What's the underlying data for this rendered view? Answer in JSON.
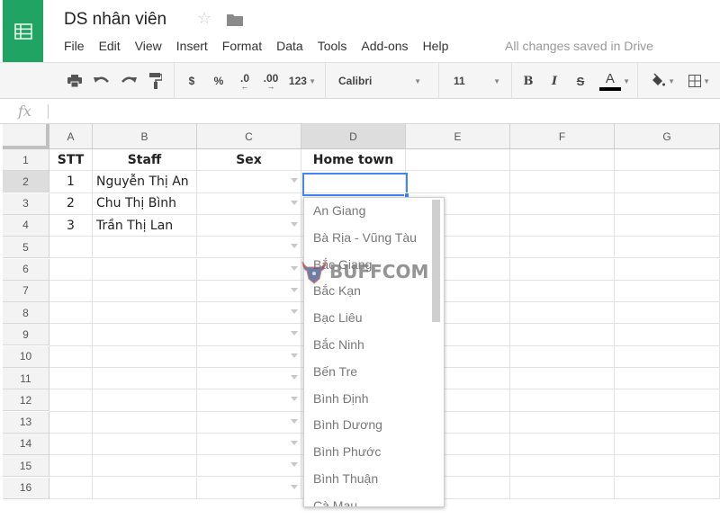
{
  "app": {
    "doc_title": "DS nhân viên",
    "save_status": "All changes saved in Drive",
    "brand_color": "#1fa463",
    "selection_color": "#4285f4"
  },
  "menu": [
    "File",
    "Edit",
    "View",
    "Insert",
    "Format",
    "Data",
    "Tools",
    "Add-ons",
    "Help"
  ],
  "toolbar": {
    "currency": "$",
    "percent": "%",
    "decrease_decimal": ".0",
    "increase_decimal": ".00",
    "more_formats": "123",
    "font": "Calibri",
    "font_size": "11",
    "bold": "B",
    "italic": "I",
    "strikethrough": "S",
    "text_color": "A"
  },
  "formula_bar": {
    "fx_label": "fx",
    "value": ""
  },
  "sheet": {
    "columns": [
      "A",
      "B",
      "C",
      "D",
      "E",
      "F",
      "G"
    ],
    "rows": [
      "1",
      "2",
      "3",
      "4",
      "5",
      "6",
      "7",
      "8",
      "9",
      "10",
      "11",
      "12",
      "13",
      "14",
      "15",
      "16"
    ],
    "header_row": {
      "A": "STT",
      "B": "Staff",
      "C": "Sex",
      "D": "Home town"
    },
    "data": [
      {
        "A": "1",
        "B": "Nguyễn Thị An",
        "C": "",
        "D": ""
      },
      {
        "A": "2",
        "B": "Chu Thị Bình",
        "C": "",
        "D": ""
      },
      {
        "A": "3",
        "B": "Trần Thị Lan",
        "C": "",
        "D": ""
      }
    ],
    "active_cell": "D2"
  },
  "dropdown": {
    "options": [
      "An Giang",
      "Bà Rịa - Vũng Tàu",
      "Bắc Giang",
      "Bắc Kạn",
      "Bạc Liêu",
      "Bắc Ninh",
      "Bến Tre",
      "Bình Định",
      "Bình Dương",
      "Bình Phước",
      "Bình Thuận",
      "Cà Mau"
    ]
  },
  "watermark": {
    "text": "BUFFCOM"
  }
}
